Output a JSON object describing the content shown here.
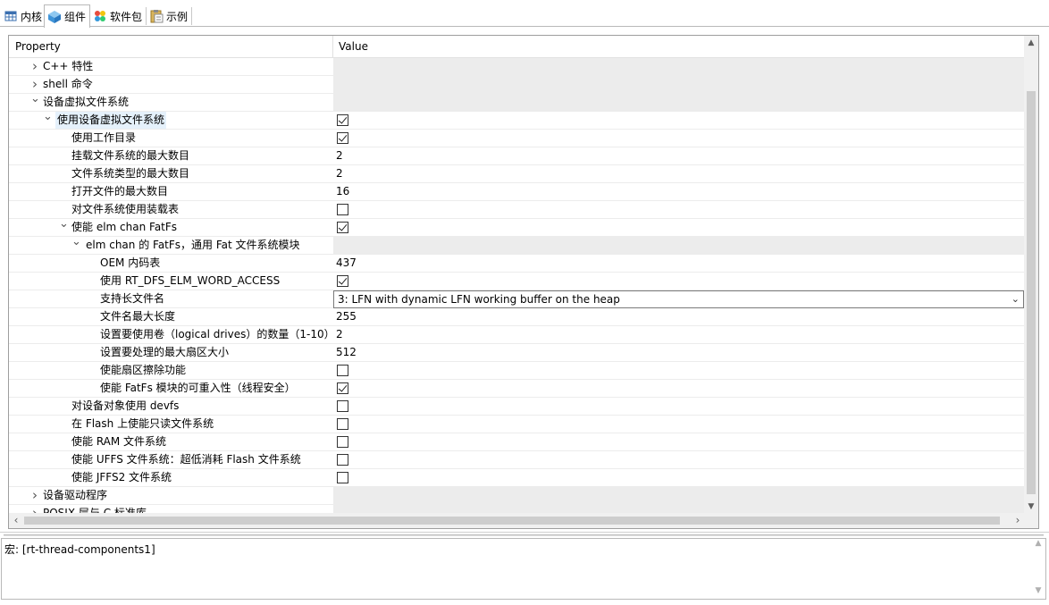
{
  "tabs": [
    {
      "label": "内核",
      "icon": "table-icon"
    },
    {
      "label": "组件",
      "icon": "cube-icon",
      "active": true
    },
    {
      "label": "软件包",
      "icon": "packages-icon"
    },
    {
      "label": "示例",
      "icon": "clipboard-icon"
    }
  ],
  "table": {
    "header_property": "Property",
    "header_value": "Value",
    "rows": [
      {
        "label": "C++ 特性",
        "level": 0,
        "arrow": "right",
        "type": "group"
      },
      {
        "label": "shell 命令",
        "level": 0,
        "arrow": "right",
        "type": "group"
      },
      {
        "label": "设备虚拟文件系统",
        "level": 0,
        "arrow": "down",
        "type": "group"
      },
      {
        "label": "使用设备虚拟文件系统",
        "level": 1,
        "arrow": "down",
        "type": "check",
        "checked": true,
        "selected": true
      },
      {
        "label": "使用工作目录",
        "level": 2,
        "type": "check",
        "checked": true
      },
      {
        "label": "挂载文件系统的最大数目",
        "level": 2,
        "type": "text",
        "value": "2"
      },
      {
        "label": "文件系统类型的最大数目",
        "level": 2,
        "type": "text",
        "value": "2"
      },
      {
        "label": "打开文件的最大数目",
        "level": 2,
        "type": "text",
        "value": "16"
      },
      {
        "label": "对文件系统使用装载表",
        "level": 2,
        "type": "check",
        "checked": false
      },
      {
        "label": "使能 elm chan FatFs",
        "level": 2,
        "arrow": "down",
        "type": "check",
        "checked": true
      },
      {
        "label": "elm chan 的 FatFs，通用 Fat 文件系统模块",
        "level": 3,
        "arrow": "down",
        "type": "group"
      },
      {
        "label": "OEM 内码表",
        "level": 4,
        "type": "text",
        "value": "437"
      },
      {
        "label": "使用 RT_DFS_ELM_WORD_ACCESS",
        "level": 4,
        "type": "check",
        "checked": true
      },
      {
        "label": "支持长文件名",
        "level": 4,
        "type": "select",
        "value": "3: LFN with dynamic LFN working buffer on the heap"
      },
      {
        "label": "文件名最大长度",
        "level": 4,
        "type": "text",
        "value": "255"
      },
      {
        "label": "设置要使用卷（logical drives）的数量（1-10）",
        "level": 4,
        "type": "text",
        "value": "2"
      },
      {
        "label": "设置要处理的最大扇区大小",
        "level": 4,
        "type": "text",
        "value": "512"
      },
      {
        "label": "使能扇区擦除功能",
        "level": 4,
        "type": "check",
        "checked": false
      },
      {
        "label": "使能 FatFs 模块的可重入性（线程安全）",
        "level": 4,
        "type": "check",
        "checked": true
      },
      {
        "label": "对设备对象使用 devfs",
        "level": 2,
        "type": "check",
        "checked": false
      },
      {
        "label": "在 Flash 上使能只读文件系统",
        "level": 2,
        "type": "check",
        "checked": false
      },
      {
        "label": "使能 RAM 文件系统",
        "level": 2,
        "type": "check",
        "checked": false
      },
      {
        "label": "使能 UFFS 文件系统：超低消耗 Flash 文件系统",
        "level": 2,
        "type": "check",
        "checked": false
      },
      {
        "label": "使能 JFFS2 文件系统",
        "level": 2,
        "type": "check",
        "checked": false
      },
      {
        "label": "设备驱动程序",
        "level": 0,
        "arrow": "right",
        "type": "group"
      },
      {
        "label": "POSIX 层与 C 标准库",
        "level": 0,
        "arrow": "right",
        "type": "group"
      }
    ]
  },
  "bottom": {
    "text": "宏: [rt-thread-components1]"
  }
}
